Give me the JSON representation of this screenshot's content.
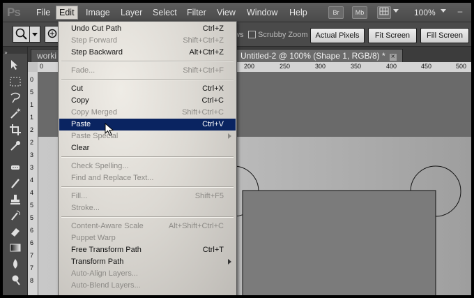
{
  "app_logo": "Ps",
  "menubar": {
    "items": [
      "File",
      "Edit",
      "Image",
      "Layer",
      "Select",
      "Filter",
      "View",
      "Window",
      "Help"
    ],
    "bridge_badge": "Br",
    "minibridge_badge": "Mb",
    "zoom": "100%",
    "win_min": "–",
    "win_close": "✕"
  },
  "options": {
    "partial_label": "ws",
    "scrubby_zoom": "Scrubby Zoom",
    "actual_pixels": "Actual Pixels",
    "fit_screen": "Fit Screen",
    "fill_screen": "Fill Screen"
  },
  "tabs": [
    {
      "label": "worki"
    },
    {
      "label": "Untitled-2 @ 100% (Shape 1, RGB/8) *",
      "close": "×"
    }
  ],
  "ruler_top_labels": [
    "0",
    "200",
    "250",
    "300",
    "350",
    "400",
    "450",
    "500"
  ],
  "ruler_left_labels": [
    "0",
    "5",
    "1",
    "1",
    "2",
    "2",
    "3",
    "3",
    "4",
    "4",
    "5",
    "5",
    "6",
    "6",
    "7",
    "7",
    "8"
  ],
  "edit_menu": {
    "items": [
      {
        "label": "Undo Cut Path",
        "shortcut": "Ctrl+Z",
        "state": "en"
      },
      {
        "label": "Step Forward",
        "shortcut": "Shift+Ctrl+Z",
        "state": "dis"
      },
      {
        "label": "Step Backward",
        "shortcut": "Alt+Ctrl+Z",
        "state": "en"
      },
      {
        "sep": true
      },
      {
        "label": "Fade...",
        "shortcut": "Shift+Ctrl+F",
        "state": "dis"
      },
      {
        "sep": true
      },
      {
        "label": "Cut",
        "shortcut": "Ctrl+X",
        "state": "en"
      },
      {
        "label": "Copy",
        "shortcut": "Ctrl+C",
        "state": "en"
      },
      {
        "label": "Copy Merged",
        "shortcut": "Shift+Ctrl+C",
        "state": "dis"
      },
      {
        "label": "Paste",
        "shortcut": "Ctrl+V",
        "state": "sel"
      },
      {
        "label": "Paste Special",
        "shortcut": "",
        "state": "dis",
        "submenu": true
      },
      {
        "label": "Clear",
        "shortcut": "",
        "state": "en"
      },
      {
        "sep": true
      },
      {
        "label": "Check Spelling...",
        "shortcut": "",
        "state": "dis"
      },
      {
        "label": "Find and Replace Text...",
        "shortcut": "",
        "state": "dis"
      },
      {
        "sep": true
      },
      {
        "label": "Fill...",
        "shortcut": "Shift+F5",
        "state": "dis"
      },
      {
        "label": "Stroke...",
        "shortcut": "",
        "state": "dis"
      },
      {
        "sep": true
      },
      {
        "label": "Content-Aware Scale",
        "shortcut": "Alt+Shift+Ctrl+C",
        "state": "dis"
      },
      {
        "label": "Puppet Warp",
        "shortcut": "",
        "state": "dis"
      },
      {
        "label": "Free Transform Path",
        "shortcut": "Ctrl+T",
        "state": "en"
      },
      {
        "label": "Transform Path",
        "shortcut": "",
        "state": "en",
        "submenu": true
      },
      {
        "label": "Auto-Align Layers...",
        "shortcut": "",
        "state": "dis"
      },
      {
        "label": "Auto-Blend Layers...",
        "shortcut": "",
        "state": "dis"
      }
    ]
  },
  "tools": [
    "move-icon",
    "marquee-icon",
    "lasso-icon",
    "magic-wand-icon",
    "crop-icon",
    "eyedropper-icon",
    "healing-brush-icon",
    "brush-icon",
    "clone-stamp-icon",
    "history-brush-icon",
    "eraser-icon",
    "gradient-icon",
    "blur-icon",
    "dodge-icon"
  ]
}
